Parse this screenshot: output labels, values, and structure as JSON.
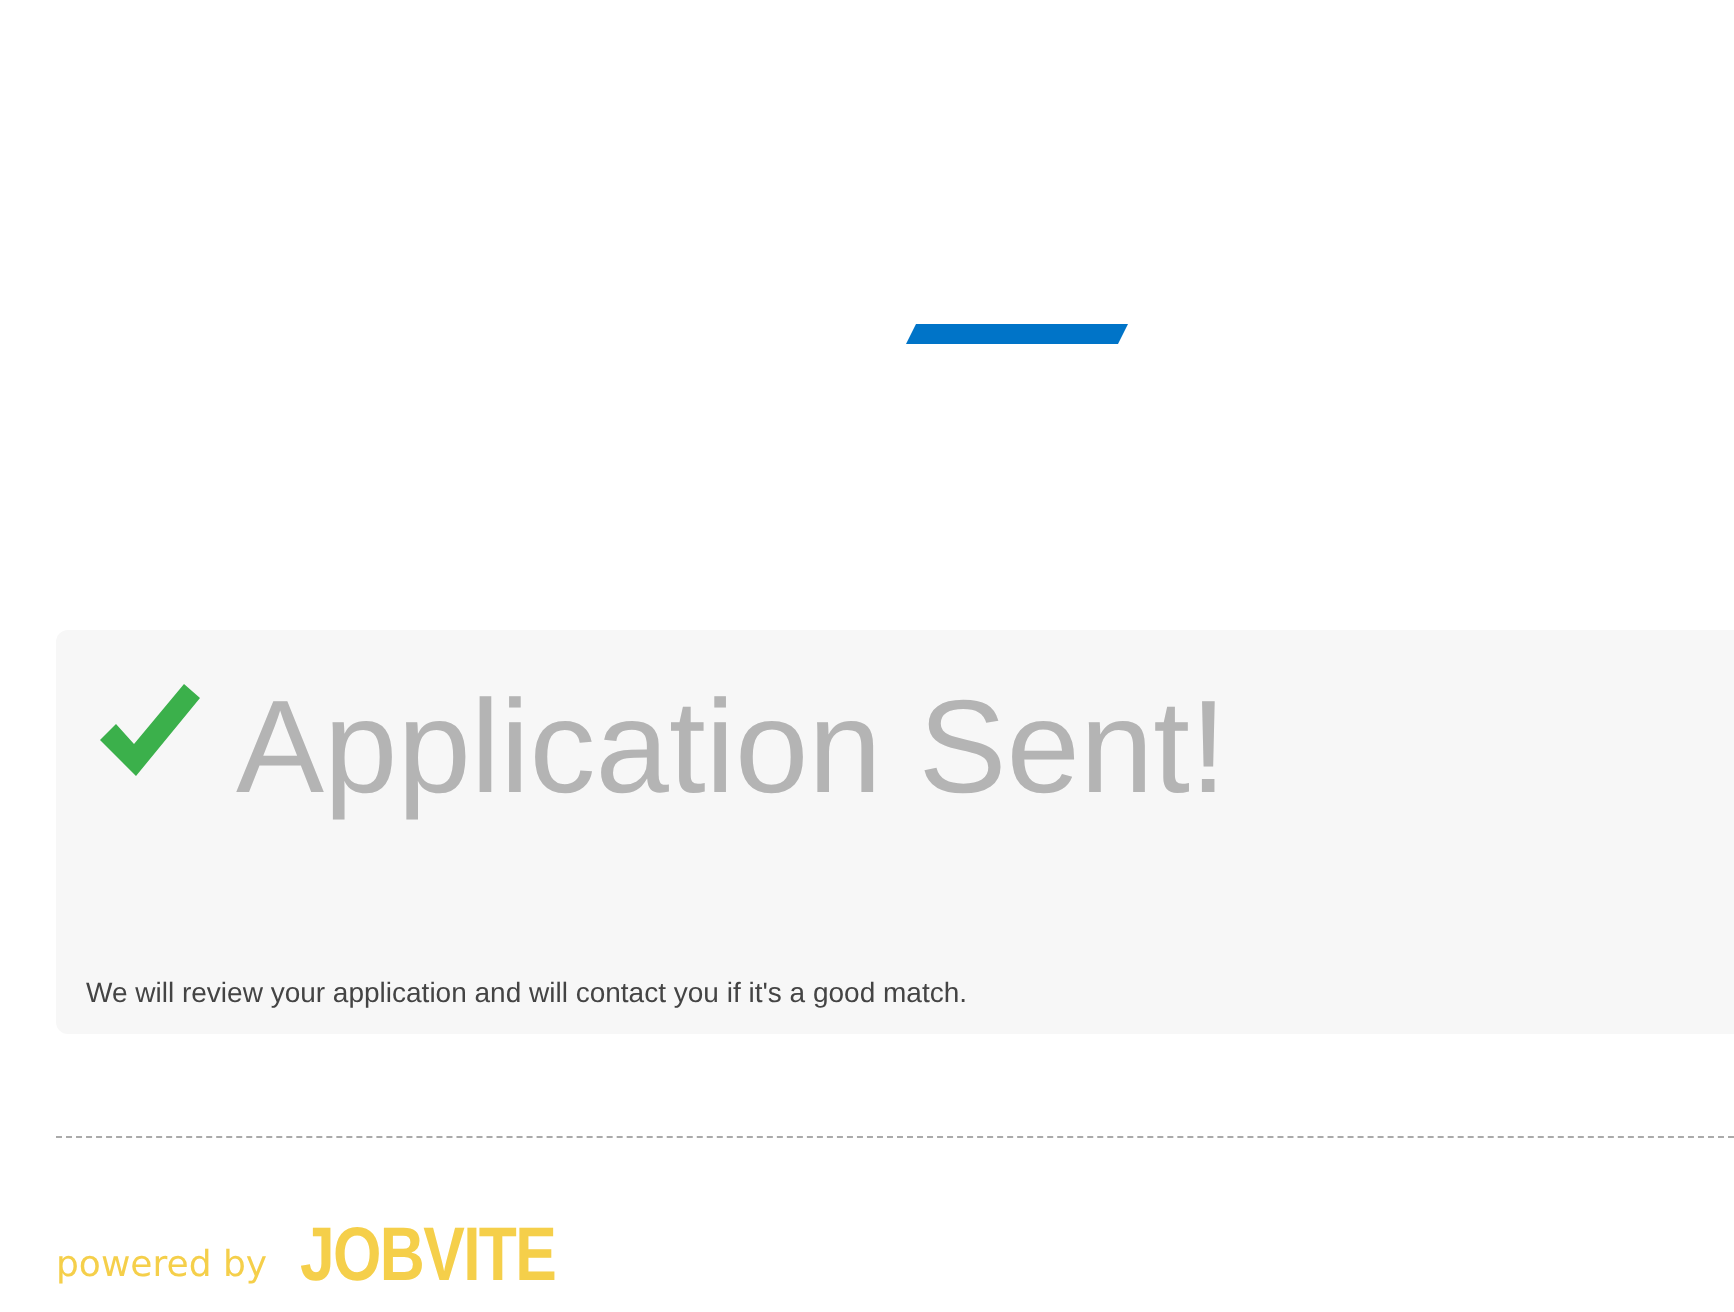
{
  "confirmation": {
    "title": "Application Sent!",
    "message": "We will review your application and will contact you if it's a good match."
  },
  "footer": {
    "powered_by": "powered by",
    "brand": "JOBVITE"
  }
}
